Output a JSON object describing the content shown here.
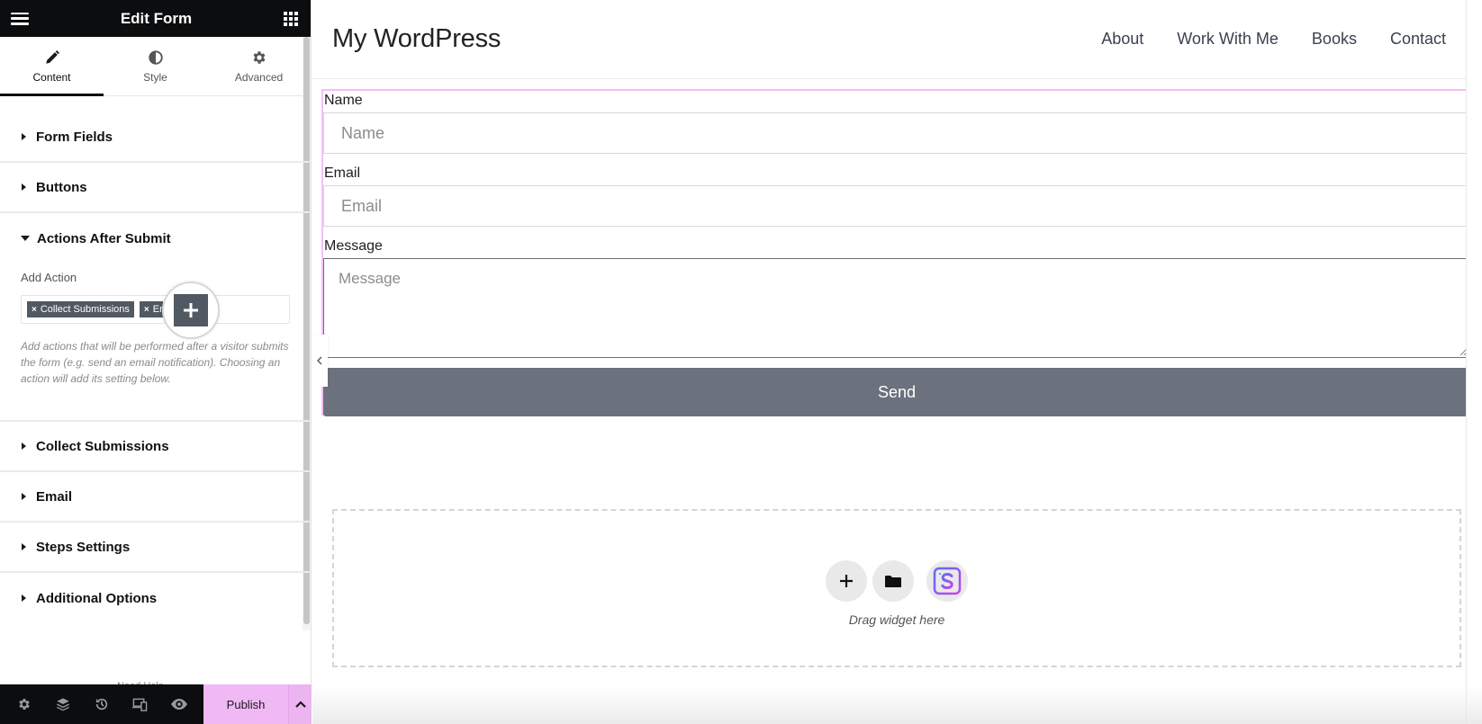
{
  "panel": {
    "title": "Edit Form",
    "tabs": [
      {
        "label": "Content",
        "icon": "pencil-icon",
        "active": true
      },
      {
        "label": "Style",
        "icon": "half-circle-icon",
        "active": false
      },
      {
        "label": "Advanced",
        "icon": "gear-icon",
        "active": false
      }
    ],
    "sections": {
      "form_fields": "Form Fields",
      "buttons": "Buttons",
      "actions_after_submit": "Actions After Submit",
      "collect_submissions": "Collect Submissions",
      "email": "Email",
      "steps_settings": "Steps Settings",
      "additional_options": "Additional Options"
    },
    "add_action": {
      "label": "Add Action",
      "chips": [
        "Collect Submissions",
        "Email"
      ],
      "chip_remove_glyph": "×",
      "description": "Add actions that will be performed after a visitor submits the form (e.g. send an email notification). Choosing an action will add its setting below."
    },
    "need_help": "Need Help",
    "bottom_bar": {
      "tools": [
        "gear-icon",
        "layers-icon",
        "history-icon",
        "responsive-icon",
        "eye-icon"
      ],
      "publish_label": "Publish"
    }
  },
  "site": {
    "title": "My WordPress",
    "nav": [
      "About",
      "Work With Me",
      "Books",
      "Contact"
    ]
  },
  "form": {
    "fields": [
      {
        "label": "Name",
        "placeholder": "Name"
      },
      {
        "label": "Email",
        "placeholder": "Email"
      },
      {
        "label": "Message",
        "placeholder": "Message"
      }
    ],
    "submit_label": "Send"
  },
  "drop_zone": {
    "text": "Drag widget here",
    "buttons": [
      "add-section-icon",
      "template-library-folder-icon",
      "starter-templates-s-icon"
    ]
  },
  "colors": {
    "accent_pink": "#f0b8f5",
    "dark": "#0c0d0e",
    "button_gray": "#6b717d",
    "chip_gray": "#515962"
  }
}
